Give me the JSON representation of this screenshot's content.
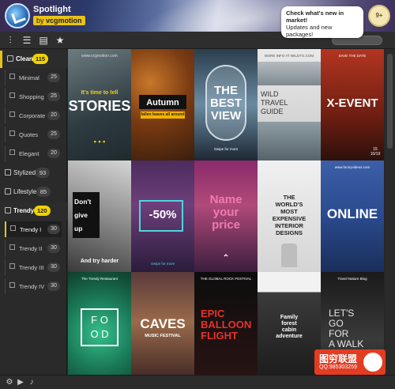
{
  "header": {
    "title": "Spotlight",
    "author_prefix": "by",
    "author_name": "vcgmotion"
  },
  "notice": {
    "line1": "Check what's new in",
    "line2": "market!",
    "line3": "Updates and new",
    "line4": "packages!",
    "count": "9+"
  },
  "toolbar": {
    "icons": [
      "sliders-icon",
      "list-icon",
      "new-file-icon",
      "star-icon"
    ]
  },
  "sidebar": {
    "categories": [
      {
        "label": "Clean",
        "count": "115"
      },
      {
        "label": "Stylized",
        "count": "93"
      },
      {
        "label": "Lifestyle",
        "count": "85"
      },
      {
        "label": "Trendy",
        "count": "120"
      }
    ],
    "clean_items": [
      {
        "label": "Minimal",
        "count": "25"
      },
      {
        "label": "Shopping",
        "count": "25"
      },
      {
        "label": "Corporate",
        "count": "20"
      },
      {
        "label": "Quotes",
        "count": "25"
      },
      {
        "label": "Elegant",
        "count": "20"
      }
    ],
    "trendy_items": [
      {
        "label": "Trendy I",
        "count": "30"
      },
      {
        "label": "Trendy II",
        "count": "30"
      },
      {
        "label": "Trendy III",
        "count": "30"
      },
      {
        "label": "Trendy IV",
        "count": "30"
      }
    ]
  },
  "tiles": {
    "t1": {
      "top": "www.vcgmotion.com",
      "sub": "It's time to tell",
      "title": "STORIES"
    },
    "t2": {
      "title": "Autumn",
      "sub": "fallen leaves all around"
    },
    "t3": {
      "title1": "THE",
      "title2": "BEST",
      "title3": "VIEW",
      "foot": "Swipe for more"
    },
    "t4": {
      "top": "MORE INFO AT WILDTG.COM",
      "l1": "WILD",
      "l2": "TRAVEL",
      "l3": "GUIDE"
    },
    "t5": {
      "top": "SAVE THE DATE",
      "title": "X-EVENT",
      "d1": "15",
      "d2": "10",
      "d3": "10/19"
    },
    "t6": {
      "l1": "Don't",
      "l2": "give",
      "l3": "up",
      "foot": "And try harder"
    },
    "t7": {
      "title": "-50%",
      "foot": "Swipe for more"
    },
    "t8": {
      "l1": "Name",
      "l2": "your",
      "l3": "price"
    },
    "t9": {
      "l1": "THE",
      "l2": "WORLD'S",
      "l3": "MOST",
      "l4": "EXPENSIVE",
      "l5": "INTERIOR",
      "l6": "DESIGNS"
    },
    "t10": {
      "top": "www.funnyvideos.com",
      "title": "ONLINE"
    },
    "t11": {
      "top": "The Trendy Restaurant",
      "l1": "F O",
      "l2": "O D"
    },
    "t12": {
      "title": "CAVES",
      "sub": "MUSIC FESTIVAL"
    },
    "t13": {
      "top": "THE GLOBAL ROCK FESTIVAL",
      "l1": "EPIC",
      "l2": "BALLOON",
      "l3": "FLIGHT"
    },
    "t14": {
      "l1": "Family",
      "l2": "forest",
      "l3": "cabin",
      "l4": "adventure"
    },
    "t15": {
      "top": "Travel Nature Blog",
      "l1": "LET'S",
      "l2": "GO",
      "l3": "FOR",
      "l4": "A WALK"
    }
  },
  "watermark": {
    "title": "图穷联盟",
    "sub": "QQ:985303259"
  },
  "bottombar": {
    "icons": [
      "settings-icon",
      "play-icon",
      "music-icon"
    ]
  }
}
